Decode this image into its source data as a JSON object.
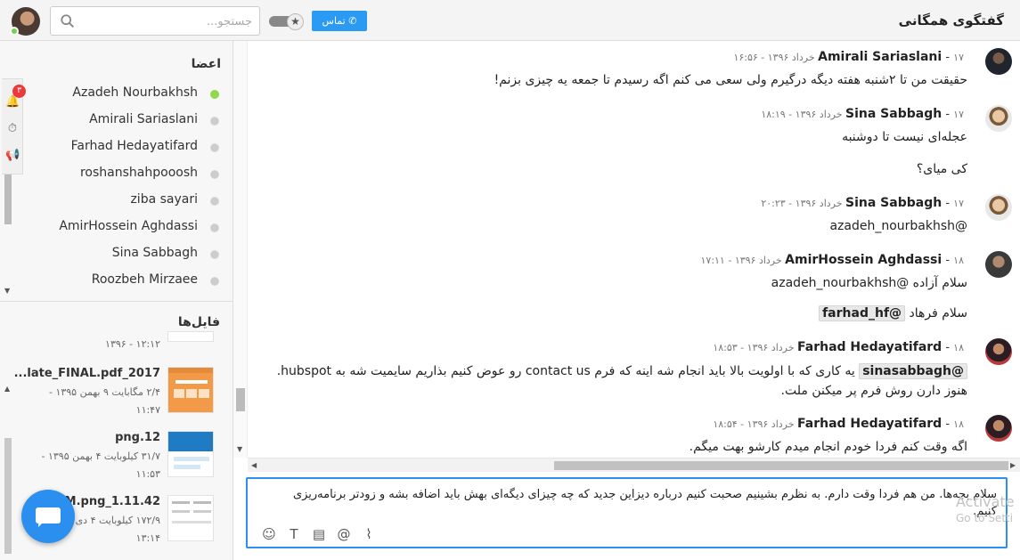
{
  "header": {
    "title": "گفتگوی همگانی",
    "call_label": "تماس",
    "search_placeholder": "جستجو..."
  },
  "members": {
    "title": "اعضا",
    "items": [
      {
        "name": "Azadeh Nourbakhsh",
        "online": true
      },
      {
        "name": "Amirali Sariaslani",
        "online": false
      },
      {
        "name": "Farhad Hedayatifard",
        "online": false
      },
      {
        "name": "roshanshahpooosh",
        "online": false
      },
      {
        "name": "ziba sayari",
        "online": false
      },
      {
        "name": "AmirHossein Aghdassi",
        "online": false
      },
      {
        "name": "Sina Sabbagh",
        "online": false
      },
      {
        "name": "Roozbeh Mirzaee",
        "online": false
      }
    ]
  },
  "notifications": {
    "count": "۳"
  },
  "files": {
    "title": "فایل‌ها",
    "partial_time": "۱۲:۱۲ - ۱۳۹۶",
    "items": [
      {
        "name": "late_FINAL.pdf_2017...",
        "meta1": "۲/۴ مگابایت ۹ بهمن ۱۳۹۵ -",
        "meta2": "۱۱:۴۷"
      },
      {
        "name": "png.12",
        "meta1": "۳۱/۷ کیلوبایت ۴ بهمن ۱۳۹۵ -",
        "meta2": "۱۱:۵۳"
      },
      {
        "name": "1.11.42_PM.png",
        "meta1": "۱۷۲/۹ کیلوبایت ۴ دی",
        "meta2": "۱۳:۱۴"
      }
    ]
  },
  "messages": [
    {
      "author": "Amirali Sariaslani",
      "time": "۱۷ خرداد ۱۳۹۶ - ۱۶:۵۶",
      "lines": [
        "حقیقت من تا ۲شنبه هفته دیگه درگیرم ولی سعی می کنم اگه رسیدم تا جمعه یه چیزی بزنم!"
      ]
    },
    {
      "author": "Sina Sabbagh",
      "time": "۱۷ خرداد ۱۳۹۶ - ۱۸:۱۹",
      "lines": [
        "عجله‌ای نیست تا دوشنبه",
        "کی میای؟"
      ]
    },
    {
      "author": "Sina Sabbagh",
      "time": "۱۷ خرداد ۱۳۹۶ - ۲۰:۲۳",
      "lines": [
        "@azadeh_nourbakhsh"
      ]
    },
    {
      "author": "AmirHossein Aghdassi",
      "time": "۱۸ خرداد ۱۳۹۶ - ۱۷:۱۱",
      "lines": [
        "سلام آزاده @azadeh_nourbakhsh"
      ],
      "mention_line_prefix": "سلام فرهاد",
      "mention_line_tag": "@farhad_hf"
    },
    {
      "author": "Farhad Hedayatifard",
      "time": "۱۸ خرداد ۱۳۹۶ - ۱۸:۵۳",
      "mention": "@sinasabbagh",
      "body": "یه کاری که با اولویت بالا باید انجام شه اینه که فرم contact us رو عوض کنیم بذاریم سایمیت شه به hubspot. هنوز دارن روش فرم پر میکنن ملت."
    },
    {
      "author": "Farhad Hedayatifard",
      "time": "۱۸ خرداد ۱۳۹۶ - ۱۸:۵۴",
      "lines": [
        "اگه وقت کنم فردا خودم انجام میدم کارشو بهت میگم."
      ]
    }
  ],
  "composer": {
    "text": "سلام بچه‌ها. من هم فردا وقت دارم. به نظرم بشینیم صحبت کنیم درباره دیزاین جدید که چه چیزای دیگه‌ای بهش باید اضافه بشه و زودتر برنامه‌ریزی کنیم."
  },
  "watermark": {
    "line1": "Activate",
    "line2": "Go to Setti"
  }
}
